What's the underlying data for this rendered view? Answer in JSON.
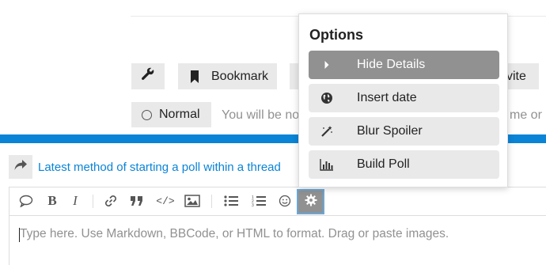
{
  "topic_footer": {
    "bookmark_label": "Bookmark",
    "invite_label": "vite",
    "normal_label": "Normal",
    "notify_text_left": "You will be no",
    "notify_text_right": "me or"
  },
  "composer": {
    "reply_title": "Latest method of starting a poll within a thread",
    "placeholder": "Type here. Use Markdown, BBCode, or HTML to format. Drag or paste images.",
    "accent_color": "#0a84d6"
  },
  "toolbar": {
    "buttons": [
      {
        "name": "quote-icon"
      },
      {
        "name": "bold-icon",
        "text": "B"
      },
      {
        "name": "italic-icon",
        "text": "I"
      },
      {
        "name": "link-icon"
      },
      {
        "name": "blockquote-icon"
      },
      {
        "name": "code-icon",
        "text": "</>"
      },
      {
        "name": "image-icon"
      },
      {
        "name": "bullet-list-icon"
      },
      {
        "name": "numbered-list-icon"
      },
      {
        "name": "emoji-icon"
      },
      {
        "name": "gear-icon"
      }
    ]
  },
  "options_menu": {
    "title": "Options",
    "items": [
      {
        "label": "Hide Details",
        "icon": "caret-right-icon",
        "active": true
      },
      {
        "label": "Insert date",
        "icon": "globe-icon",
        "active": false
      },
      {
        "label": "Blur Spoiler",
        "icon": "magic-icon",
        "active": false
      },
      {
        "label": "Build Poll",
        "icon": "bar-chart-icon",
        "active": false
      }
    ]
  }
}
